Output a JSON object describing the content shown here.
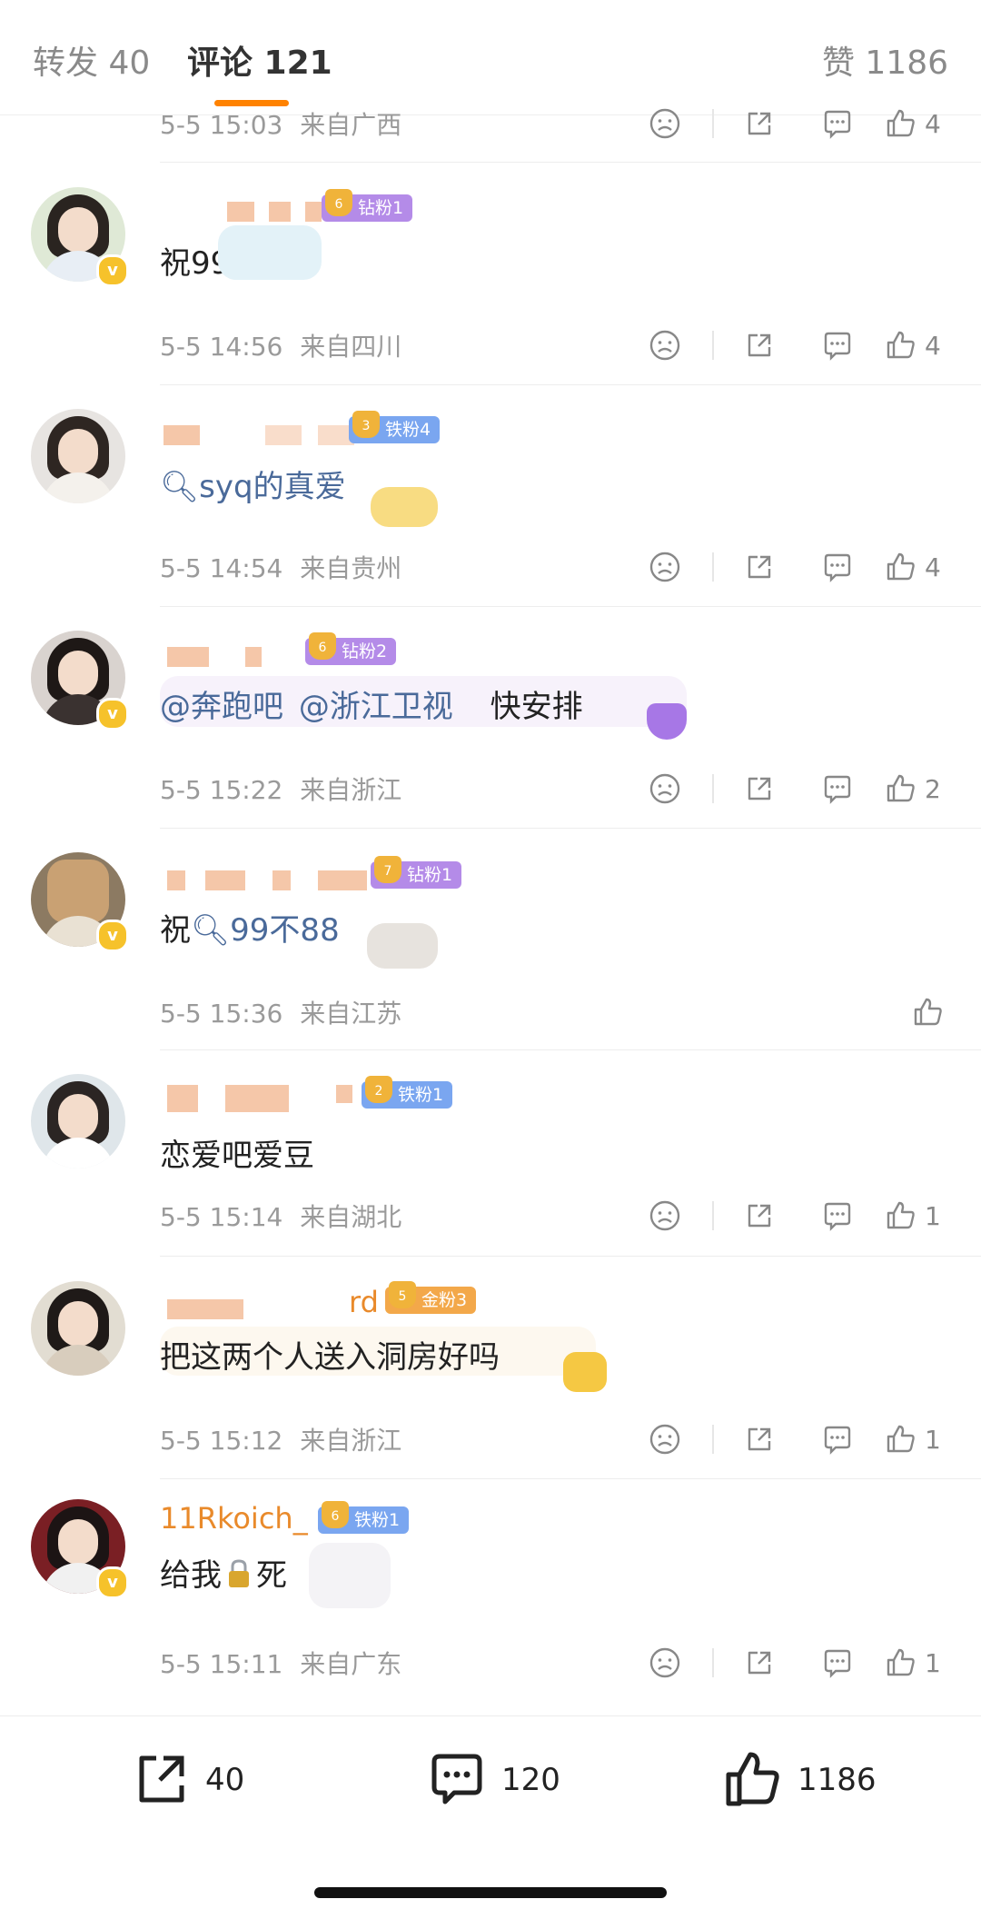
{
  "header": {
    "tab_repost": "转发 40",
    "tab_comments": "评论 121",
    "tab_likes": "赞 1186"
  },
  "comments": [
    {
      "username": "",
      "badge": "",
      "text": "",
      "time": "5-5 15:03",
      "location": "来自广西",
      "likes": "4"
    },
    {
      "username": "",
      "badge": "钻粉1",
      "text": "祝99",
      "time": "5-5 14:56",
      "location": "来自四川",
      "likes": "4"
    },
    {
      "username": "",
      "badge": "铁粉4",
      "text": "syq的真爱",
      "time": "5-5 14:54",
      "location": "来自贵州",
      "likes": "4"
    },
    {
      "username": "",
      "badge": "钻粉2",
      "text_mention1": "@奔跑吧",
      "text_mention2": "@浙江卫视",
      "text_rest": "快安排",
      "time": "5-5 15:22",
      "location": "来自浙江",
      "likes": "2"
    },
    {
      "username": "",
      "badge": "钻粉1",
      "text_prefix": "祝",
      "text_link": "99不88",
      "time": "5-5 15:36",
      "location": "来自江苏",
      "likes": ""
    },
    {
      "username": "",
      "badge": "铁粉1",
      "text": "恋爱吧爱豆",
      "time": "5-5 15:14",
      "location": "来自湖北",
      "likes": "1"
    },
    {
      "username": "rd",
      "badge": "金粉3",
      "text": "把这两个人送入洞房好吗",
      "time": "5-5 15:12",
      "location": "来自浙江",
      "likes": "1"
    },
    {
      "username": "11Rkoich_",
      "badge": "铁粉1",
      "text_prefix": "给我",
      "text_suffix": "死",
      "time": "5-5 15:11",
      "location": "来自广东",
      "likes": "1"
    }
  ],
  "bottom_bar": {
    "repost_count": "40",
    "comment_count": "120",
    "like_count": "1186"
  },
  "colors": {
    "accent": "#ff8200",
    "link": "#4a6a9a",
    "badge_diamond": "#b48be8",
    "badge_iron": "#7aa6f0",
    "badge_gold": "#f3a84a"
  },
  "icons": [
    "dislike-icon",
    "share-icon",
    "comment-icon",
    "like-icon",
    "search-icon",
    "lock-icon",
    "verified-icon"
  ]
}
